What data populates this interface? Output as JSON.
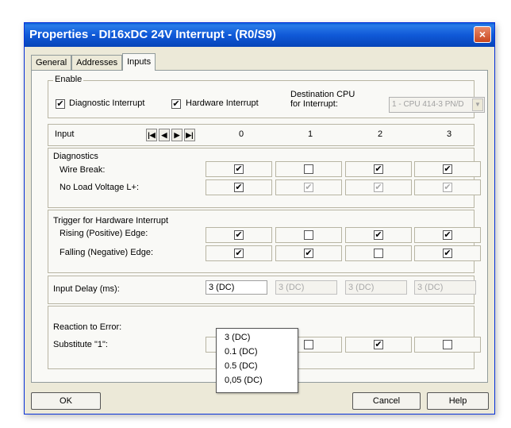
{
  "window": {
    "title": "Properties - DI16xDC 24V Interrupt - (R0/S9)",
    "close_glyph": "×"
  },
  "tabs": [
    {
      "label": "General"
    },
    {
      "label": "Addresses"
    },
    {
      "label": "Inputs"
    }
  ],
  "enable": {
    "title": "Enable",
    "diagnostic_label": "Diagnostic Interrupt",
    "diagnostic_checked": "✔",
    "hardware_label": "Hardware Interrupt",
    "hardware_checked": "✔",
    "destination_label_line1": "Destination CPU",
    "destination_label_line2": "for Interrupt:",
    "destination_value": "1 - CPU 414-3 PN/D",
    "dropdown_arrow": "▼"
  },
  "header": {
    "input_label": "Input",
    "nav": [
      "|◀",
      "◀",
      "▶",
      "▶|"
    ],
    "columns": [
      "0",
      "1",
      "2",
      "3"
    ]
  },
  "diagnostics": {
    "title": "Diagnostics",
    "wire_break_label": "Wire Break:",
    "wire_break": [
      "✔",
      "",
      "✔",
      "✔"
    ],
    "no_load_label": "No Load Voltage L+:",
    "no_load": [
      "✔",
      "✔",
      "✔",
      "✔"
    ]
  },
  "trigger": {
    "title": "Trigger for Hardware Interrupt",
    "rising_label": "Rising (Positive) Edge:",
    "rising": [
      "✔",
      "",
      "✔",
      "✔"
    ],
    "falling_label": "Falling (Negative) Edge:",
    "falling": [
      "✔",
      "✔",
      "",
      "✔"
    ]
  },
  "delay": {
    "label": "Input Delay (ms):",
    "values": [
      "3 (DC)",
      "3 (DC)",
      "3 (DC)",
      "3 (DC)"
    ],
    "options": [
      "3 (DC)",
      "0.1 (DC)",
      "0.5 (DC)",
      "0,05 (DC)"
    ]
  },
  "reaction": {
    "title": "Reaction to Error:",
    "substitute_label": "Substitute \"1\":",
    "substitute": [
      "",
      "",
      "✔",
      ""
    ]
  },
  "buttons": {
    "ok": "OK",
    "cancel": "Cancel",
    "help": "Help"
  }
}
